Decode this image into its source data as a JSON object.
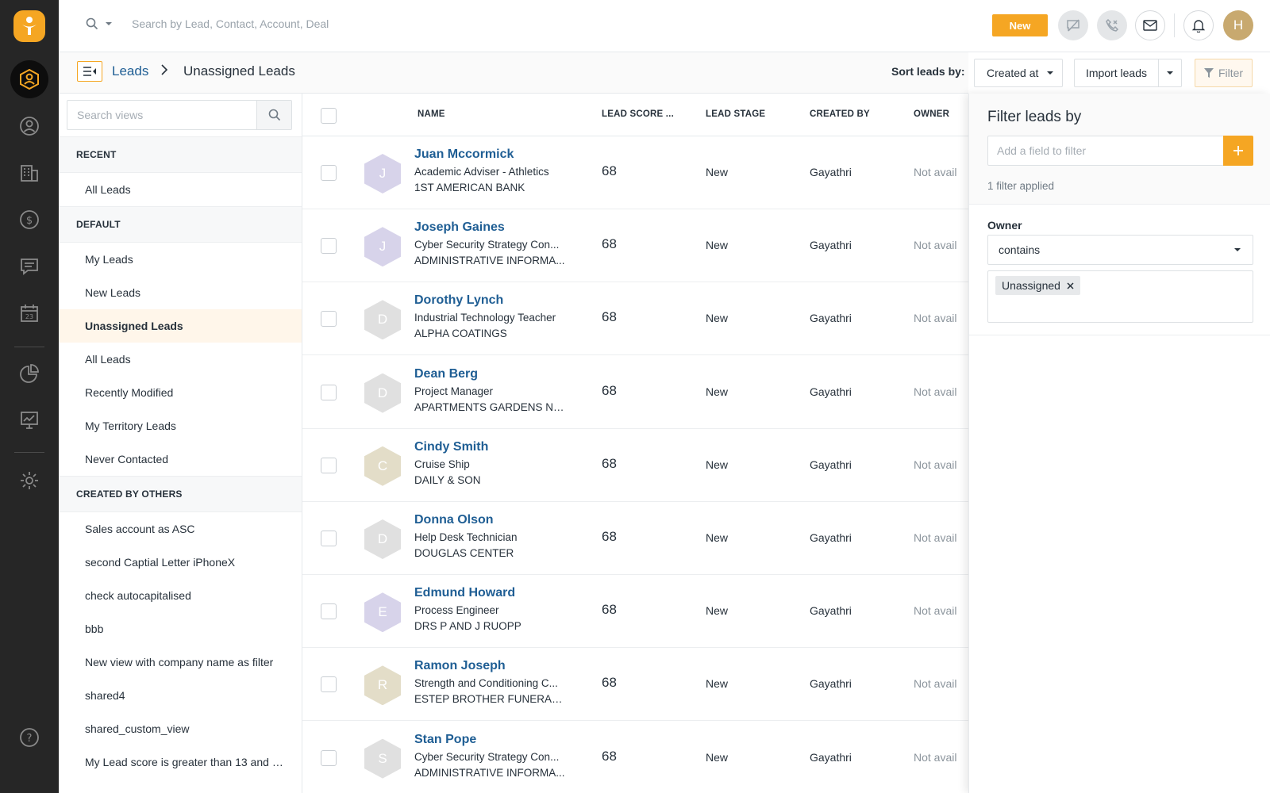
{
  "topbar": {
    "search_placeholder": "Search by Lead, Contact, Account, Deal",
    "new_label": "New",
    "avatar_initial": "H"
  },
  "header": {
    "breadcrumb_root": "Leads",
    "breadcrumb_current": "Unassigned Leads",
    "sort_label": "Sort leads by:",
    "sort_value": "Created at",
    "import_label": "Import leads",
    "filter_label": "Filter"
  },
  "views": {
    "search_placeholder": "Search views",
    "sections": [
      {
        "title": "RECENT",
        "items": [
          "All Leads"
        ]
      },
      {
        "title": "DEFAULT",
        "items": [
          "My Leads",
          "New Leads",
          "Unassigned Leads",
          "All Leads",
          "Recently Modified",
          "My Territory Leads",
          "Never Contacted"
        ]
      },
      {
        "title": "CREATED BY OTHERS",
        "items": [
          "Sales account as ASC",
          "second Captial Letter iPhoneX",
          "check autocapitalised",
          "bbb",
          "New view with company name as filter",
          "shared4",
          "shared_custom_view",
          "My Lead score is greater than 13 and l..."
        ]
      }
    ],
    "active_item": "Unassigned Leads"
  },
  "table": {
    "columns": [
      "NAME",
      "LEAD SCORE ...",
      "LEAD STAGE",
      "CREATED BY",
      "OWNER"
    ],
    "rows": [
      {
        "initial": "J",
        "name": "Juan Mccormick",
        "title": "Academic Adviser - Athletics",
        "company": "1ST AMERICAN BANK",
        "score": "68",
        "stage": "New",
        "created_by": "Gayathri",
        "owner": "Not avail",
        "avatar_color": "#d7d3ea"
      },
      {
        "initial": "J",
        "name": "Joseph Gaines",
        "title": "Cyber Security Strategy Con...",
        "company": "ADMINISTRATIVE INFORMA...",
        "score": "68",
        "stage": "New",
        "created_by": "Gayathri",
        "owner": "Not avail",
        "avatar_color": "#d7d3ea"
      },
      {
        "initial": "D",
        "name": "Dorothy Lynch",
        "title": "Industrial Technology Teacher",
        "company": "ALPHA COATINGS",
        "score": "68",
        "stage": "New",
        "created_by": "Gayathri",
        "owner": "Not avail",
        "avatar_color": "#e0e0e0"
      },
      {
        "initial": "D",
        "name": "Dean Berg",
        "title": "Project Manager",
        "company": "APARTMENTS GARDENS NS...",
        "score": "68",
        "stage": "New",
        "created_by": "Gayathri",
        "owner": "Not avail",
        "avatar_color": "#e0e0e0"
      },
      {
        "initial": "C",
        "name": "Cindy Smith",
        "title": "Cruise Ship",
        "company": "DAILY & SON",
        "score": "68",
        "stage": "New",
        "created_by": "Gayathri",
        "owner": "Not avail",
        "avatar_color": "#e3ddc8"
      },
      {
        "initial": "D",
        "name": "Donna Olson",
        "title": "Help Desk Technician",
        "company": "DOUGLAS CENTER",
        "score": "68",
        "stage": "New",
        "created_by": "Gayathri",
        "owner": "Not avail",
        "avatar_color": "#e0e0e0"
      },
      {
        "initial": "E",
        "name": "Edmund Howard",
        "title": "Process Engineer",
        "company": "DRS P AND J RUOPP",
        "score": "68",
        "stage": "New",
        "created_by": "Gayathri",
        "owner": "Not avail",
        "avatar_color": "#d7d3ea"
      },
      {
        "initial": "R",
        "name": "Ramon Joseph",
        "title": "Strength and Conditioning C...",
        "company": "ESTEP BROTHER FUNERAL ...",
        "score": "68",
        "stage": "New",
        "created_by": "Gayathri",
        "owner": "Not avail",
        "avatar_color": "#e3ddc8"
      },
      {
        "initial": "S",
        "name": "Stan Pope",
        "title": "Cyber Security Strategy Con...",
        "company": "ADMINISTRATIVE INFORMA...",
        "score": "68",
        "stage": "New",
        "created_by": "Gayathri",
        "owner": "Not avail",
        "avatar_color": "#e0e0e0"
      }
    ]
  },
  "filter_panel": {
    "title": "Filter leads by",
    "add_placeholder": "Add a field to filter",
    "applied_text": "1 filter applied",
    "field_label": "Owner",
    "operator": "contains",
    "tags": [
      "Unassigned"
    ]
  },
  "colors": {
    "accent": "#f5a623",
    "link": "#1f5e94",
    "rail": "#262626"
  },
  "icons": {
    "rail": [
      "leads-icon",
      "contacts-icon",
      "accounts-icon",
      "deals-icon",
      "conversations-icon",
      "calendar-icon",
      "reports-icon",
      "analytics-icon",
      "settings-icon",
      "help-icon"
    ],
    "topbar": [
      "search-icon",
      "chevron-down-icon",
      "chat-icon",
      "phone-icon",
      "mail-icon",
      "bell-icon"
    ]
  }
}
